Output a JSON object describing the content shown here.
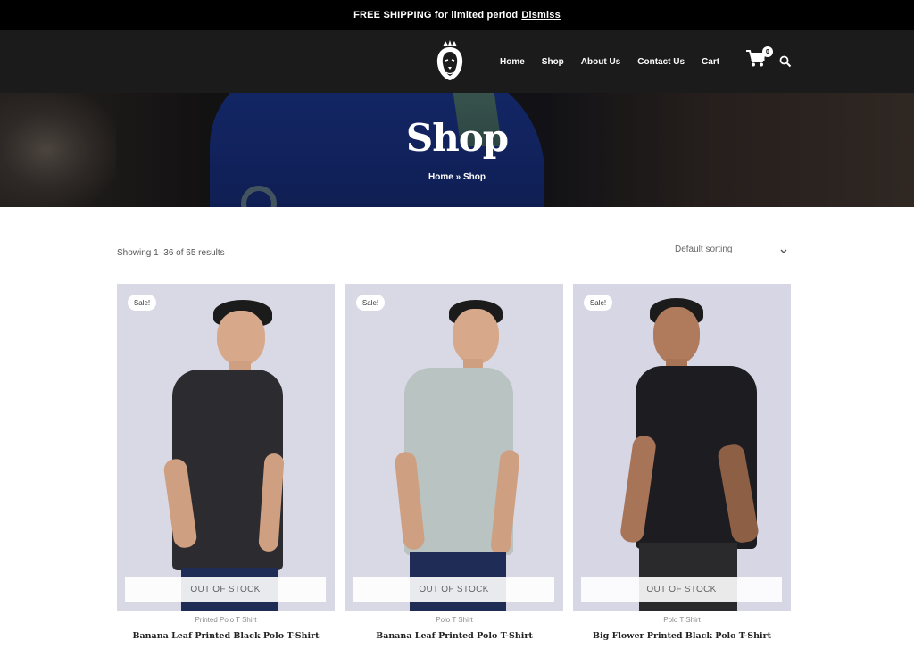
{
  "notice": {
    "text": "FREE SHIPPING for limited period",
    "dismiss": "Dismiss"
  },
  "nav": {
    "home": "Home",
    "shop": "Shop",
    "about": "About Us",
    "contact": "Contact Us",
    "cart": "Cart"
  },
  "cart": {
    "count": "0"
  },
  "hero": {
    "title": "Shop",
    "breadcrumb_home": "Home",
    "breadcrumb_sep": "»",
    "breadcrumb_current": "Shop"
  },
  "toolbar": {
    "result_count": "Showing 1–36 of 65 results",
    "sorting": "Default sorting"
  },
  "products": [
    {
      "badge": "Sale!",
      "stock": "OUT OF STOCK",
      "category": "Printed Polo T Shirt",
      "name": "Banana Leaf Printed Black Polo T-Shirt"
    },
    {
      "badge": "Sale!",
      "stock": "OUT OF STOCK",
      "category": "Polo T Shirt",
      "name": "Banana Leaf Printed Polo T-Shirt"
    },
    {
      "badge": "Sale!",
      "stock": "OUT OF STOCK",
      "category": "Polo T Shirt",
      "name": "Big Flower Printed Black Polo T-Shirt"
    }
  ],
  "colors": {
    "notice_bg": "#000000",
    "header_bg": "#1b1b1b",
    "product_bg": "#d9d9e6"
  },
  "icons": [
    "lion-logo-icon",
    "cart-icon",
    "search-icon",
    "chevron-down-icon"
  ]
}
